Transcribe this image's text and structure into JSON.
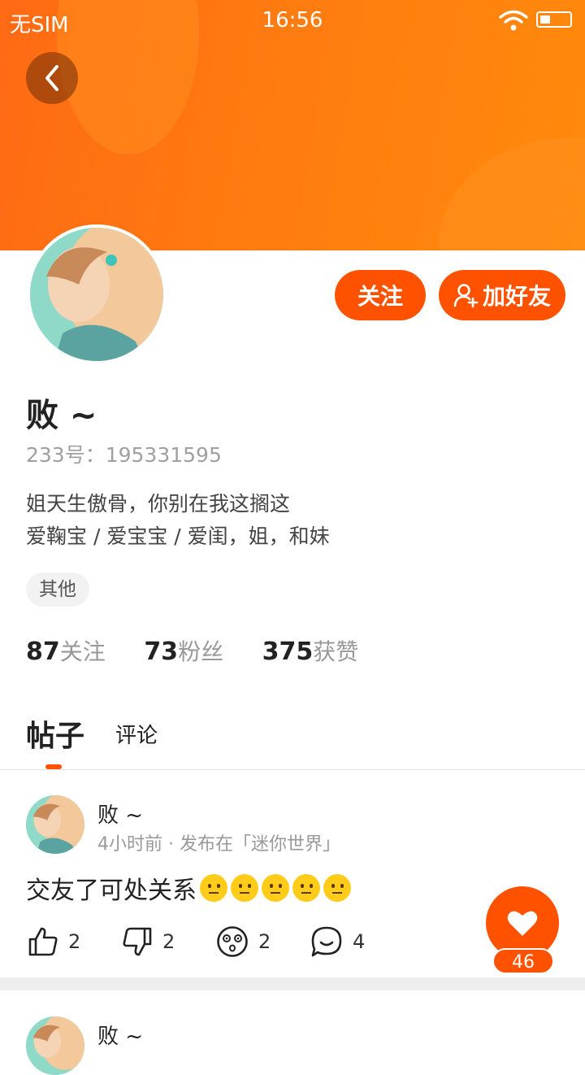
{
  "status_bar": {
    "carrier": "无SIM",
    "time": "16:56"
  },
  "profile": {
    "name": "败 ~",
    "id_label": "233号：195331595",
    "bio_lines": [
      "姐天生傲骨，你别在我这搁这",
      "爱鞠宝 / 爱宝宝 / 爱闺，姐，和妹"
    ],
    "tag": "其他",
    "stats": [
      {
        "num": "87",
        "label": "关注"
      },
      {
        "num": "73",
        "label": "粉丝"
      },
      {
        "num": "375",
        "label": "获赞"
      }
    ],
    "follow_label": "关注",
    "add_friend_label": "加好友"
  },
  "tabs": [
    {
      "label": "帖子"
    },
    {
      "label": "评论"
    }
  ],
  "posts": [
    {
      "author": "败 ~",
      "meta": "4小时前 · 发布在「迷你世界」",
      "text": "交友了可处关系",
      "emoji_count": 5,
      "actions": {
        "like": "2",
        "dislike": "2",
        "dizzy": "2",
        "comment": "4"
      }
    },
    {
      "author": "败 ~"
    }
  ],
  "fab": {
    "count": "46",
    "icon": "heart-icon"
  },
  "colors": {
    "accent": "#ff5200",
    "header": "#ff7b10"
  }
}
